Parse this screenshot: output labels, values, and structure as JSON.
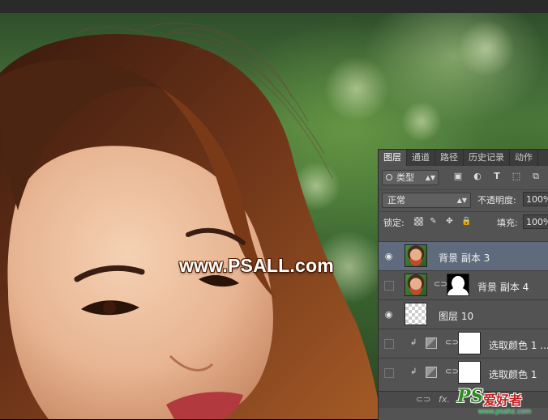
{
  "watermark": {
    "text": "www.PSALL.com"
  },
  "panel": {
    "tabs": [
      {
        "label": "图层",
        "active": true
      },
      {
        "label": "通道",
        "active": false
      },
      {
        "label": "路径",
        "active": false
      },
      {
        "label": "历史记录",
        "active": false
      },
      {
        "label": "动作",
        "active": false
      }
    ],
    "filter": {
      "label": "类型",
      "icons": [
        "image-filter-icon",
        "adjustment-filter-icon",
        "type-filter-icon",
        "shape-filter-icon",
        "smart-object-filter-icon"
      ]
    },
    "blend_mode": "正常",
    "opacity_label": "不透明度:",
    "opacity_value": "100%",
    "lock_label": "锁定:",
    "fill_label": "填充:",
    "fill_value": "100%",
    "layers": [
      {
        "name": "背景 副本 3",
        "visible": true,
        "selected": true,
        "thumb": "photo",
        "mask": null
      },
      {
        "name": "背景 副本 4",
        "visible": false,
        "selected": false,
        "thumb": "photo",
        "mask": "silhouette"
      },
      {
        "name": "图层 10",
        "visible": true,
        "selected": false,
        "thumb": "transparent",
        "mask": null
      },
      {
        "name": "选取颜色 1 ...",
        "visible": false,
        "selected": false,
        "thumb": "adjustment",
        "mask": "white",
        "clipped": true
      },
      {
        "name": "选取颜色 1",
        "visible": false,
        "selected": false,
        "thumb": "adjustment",
        "mask": "white",
        "clipped": true
      }
    ],
    "footer": {
      "link_icon": "link-icon",
      "fx_label": "fx."
    }
  },
  "corner_logo": {
    "ps": "PS",
    "cn": "爱好者",
    "url": "www.psahz.com"
  }
}
